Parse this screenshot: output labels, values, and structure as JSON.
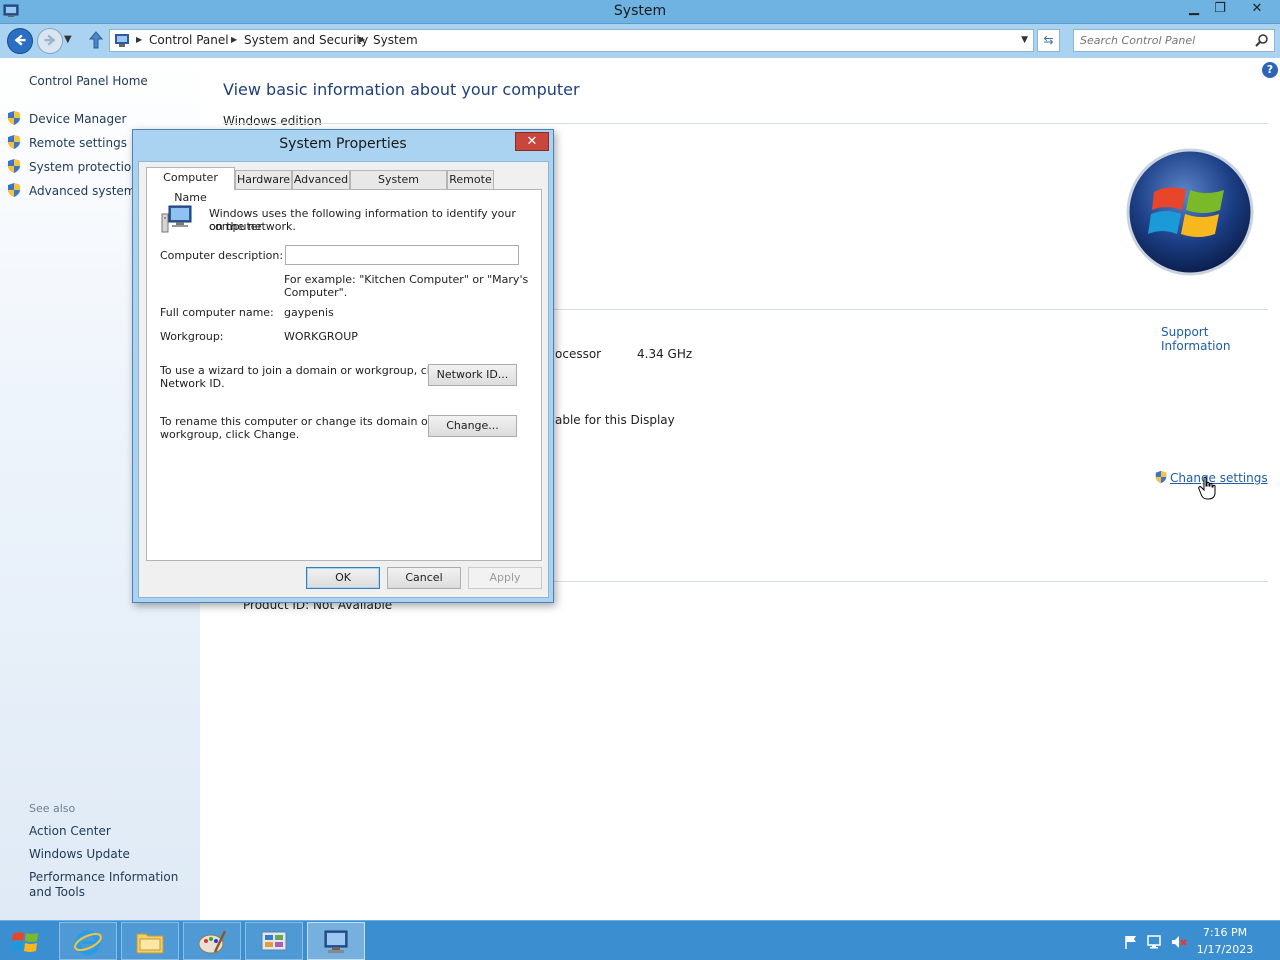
{
  "window": {
    "title": "System",
    "min_glyph": "▁",
    "max_glyph": "❐",
    "close_glyph": "✕"
  },
  "address_bar": {
    "breadcrumbs": [
      "Control Panel",
      "System and Security",
      "System"
    ],
    "search_placeholder": "Search Control Panel"
  },
  "left_nav": {
    "home": "Control Panel Home",
    "items": [
      "Device Manager",
      "Remote settings",
      "System protection",
      "Advanced system settings"
    ],
    "see_also_heading": "See also",
    "see_also": [
      "Action Center",
      "Windows Update",
      "Performance Information and Tools"
    ]
  },
  "main": {
    "heading": "View basic information about your computer",
    "section_windows_edition": "Windows edition",
    "support_link": "Support Information",
    "processor_label": "ocessor",
    "processor_value": "4.34 GHz",
    "display_text": "able for this Display",
    "change_settings": "Change settings",
    "product_id": "Product ID:  Not Available"
  },
  "dialog": {
    "title": "System Properties",
    "close_glyph": "✕",
    "tabs": [
      "Computer Name",
      "Hardware",
      "Advanced",
      "System Protection",
      "Remote"
    ],
    "active_tab": "Computer Name",
    "intro_line1": "Windows uses the following information to identify your computer",
    "intro_line2": "on the network.",
    "description_label": "Computer description:",
    "description_value": "",
    "example_line1": "For example: \"Kitchen Computer\" or \"Mary's",
    "example_line2": "Computer\".",
    "full_name_label": "Full computer name:",
    "full_name_value": "gaypenis",
    "workgroup_label": "Workgroup:",
    "workgroup_value": "WORKGROUP",
    "network_text_line1": "To use a wizard to join a domain or workgroup, click",
    "network_text_line2": "Network ID.",
    "network_button": "Network ID...",
    "rename_text_line1": "To rename this computer or change its domain or",
    "rename_text_line2": "workgroup, click Change.",
    "change_button": "Change...",
    "ok_button": "OK",
    "cancel_button": "Cancel",
    "apply_button": "Apply"
  },
  "taskbar": {
    "pinned": [
      "internet-explorer",
      "file-explorer",
      "paint",
      "control-panel",
      "system-properties"
    ],
    "clock_time": "7:16 PM",
    "clock_date": "1/17/2023"
  },
  "colors": {
    "accent": "#6fb3e3",
    "link": "#1e5ca8",
    "taskbar": "#3b8fd1"
  }
}
